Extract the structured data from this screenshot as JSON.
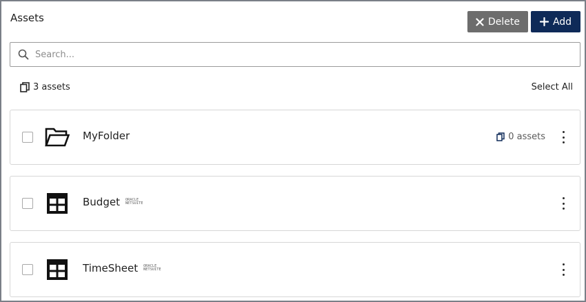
{
  "panel": {
    "title": "Assets"
  },
  "toolbar": {
    "delete_label": "Delete",
    "add_label": "Add"
  },
  "search": {
    "placeholder": "Search...",
    "value": ""
  },
  "summary": {
    "count_label": "3 assets",
    "select_all_label": "Select All"
  },
  "items": [
    {
      "name": "MyFolder",
      "type_icon": "folder-open-icon",
      "asset_count": "0 assets",
      "tag": ""
    },
    {
      "name": "Budget",
      "type_icon": "table-grid-icon",
      "asset_count": "",
      "tag": "ORACLE NETSUITE"
    },
    {
      "name": "TimeSheet",
      "type_icon": "table-grid-icon",
      "asset_count": "",
      "tag": "ORACLE NETSUITE"
    }
  ],
  "colors": {
    "add_button": "#0e2a58",
    "delete_button": "#6d6d6d",
    "border": "#7a7f87",
    "card_border": "#d6d6d6",
    "count_icon": "#0e2a58"
  }
}
